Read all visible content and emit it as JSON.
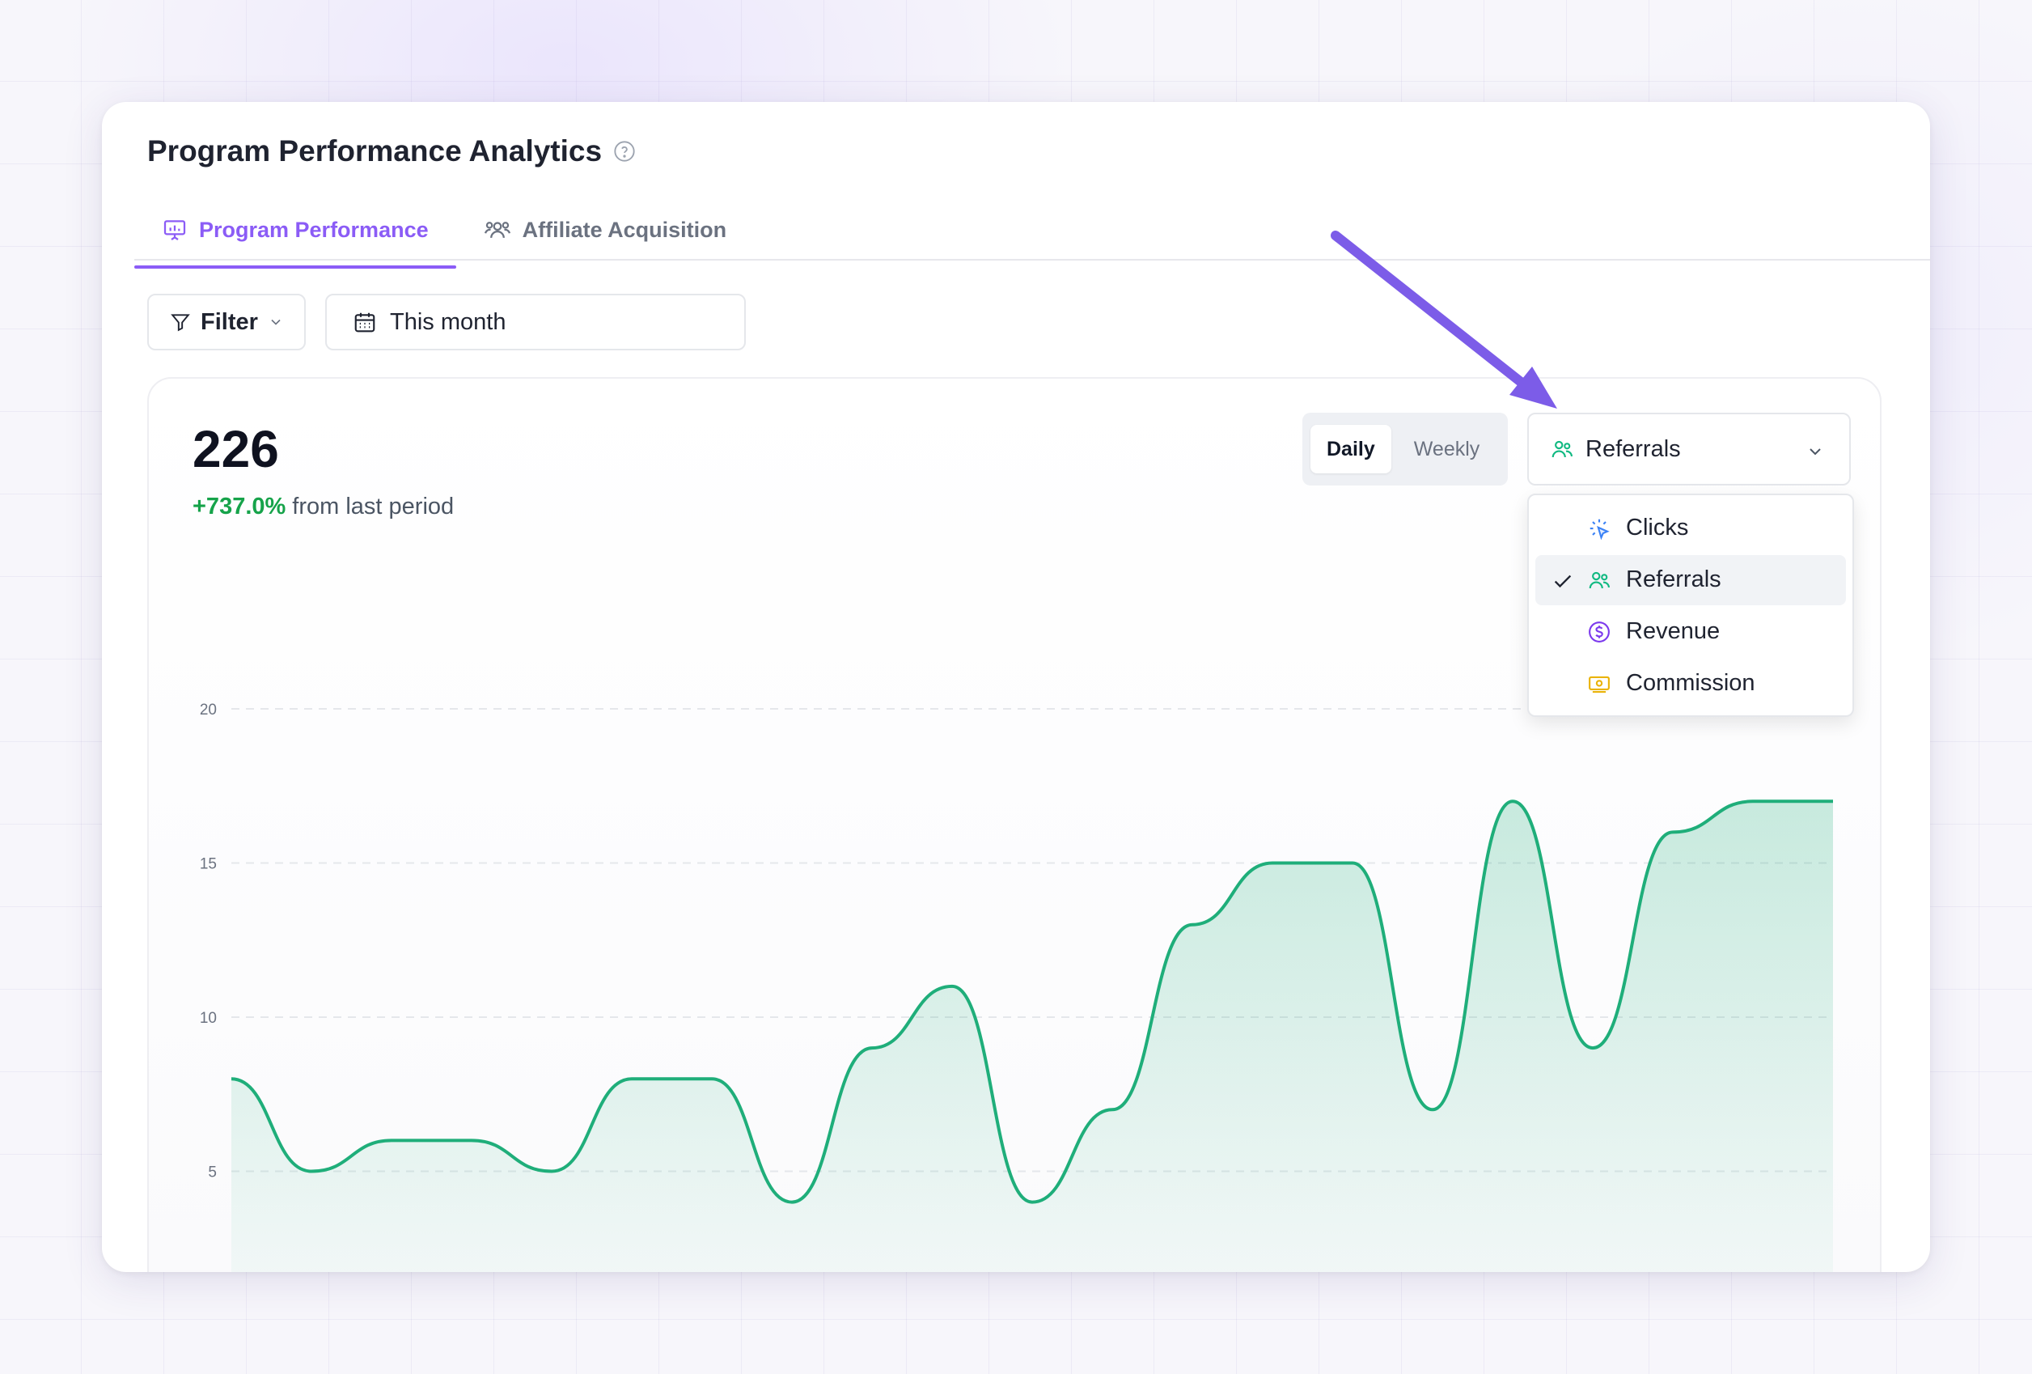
{
  "header": {
    "title": "Program Performance Analytics"
  },
  "tabs": [
    {
      "label": "Program Performance",
      "icon": "presentation-chart-icon",
      "active": true
    },
    {
      "label": "Affiliate Acquisition",
      "icon": "users-group-icon",
      "active": false
    }
  ],
  "toolbar": {
    "filter_label": "Filter",
    "date_label": "This month"
  },
  "summary": {
    "value": "226",
    "change": "+737.0%",
    "change_suffix": "from last period"
  },
  "period_toggle": {
    "options": [
      "Daily",
      "Weekly"
    ],
    "selected": "Daily"
  },
  "metric_select": {
    "selected": "Referrals",
    "options": [
      {
        "label": "Clicks",
        "icon": "cursor-click-icon"
      },
      {
        "label": "Referrals",
        "icon": "users-icon"
      },
      {
        "label": "Revenue",
        "icon": "dollar-circle-icon"
      },
      {
        "label": "Commission",
        "icon": "banknote-icon"
      }
    ]
  },
  "colors": {
    "accent": "#8b5cf6",
    "line": "#1fae7a",
    "positive": "#16a34a"
  },
  "chart_data": {
    "type": "area",
    "title": "",
    "xlabel": "",
    "ylabel": "",
    "ylim": [
      0,
      20
    ],
    "yticks": [
      0,
      5,
      10,
      15,
      20
    ],
    "grid": true,
    "series": [
      {
        "values": [
          8,
          5,
          6,
          6,
          5,
          8,
          8,
          4,
          9,
          11,
          4,
          7,
          13,
          15,
          15,
          7,
          17,
          9,
          16,
          17,
          17
        ]
      }
    ]
  }
}
